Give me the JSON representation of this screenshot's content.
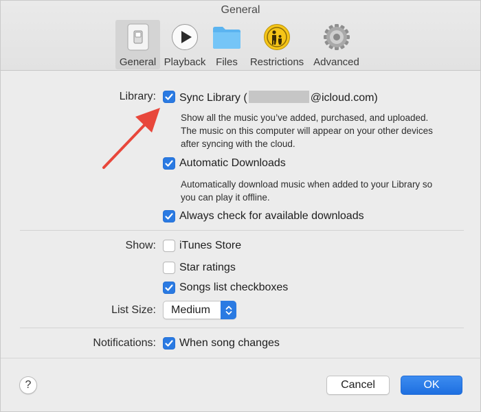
{
  "window": {
    "title": "General"
  },
  "toolbar": {
    "items": [
      {
        "label": "General",
        "icon": "general-switch-icon",
        "selected": true
      },
      {
        "label": "Playback",
        "icon": "play-icon",
        "selected": false
      },
      {
        "label": "Files",
        "icon": "folder-icon",
        "selected": false
      },
      {
        "label": "Restrictions",
        "icon": "parental-controls-icon",
        "selected": false
      },
      {
        "label": "Advanced",
        "icon": "gear-icon",
        "selected": false
      }
    ]
  },
  "library": {
    "label": "Library:",
    "sync": {
      "label_prefix": "Sync Library (",
      "label_suffix": "@icloud.com)",
      "checked": true
    },
    "sync_description": "Show all the music you’ve added, purchased, and uploaded. The music on this computer will appear on your other devices after syncing with the cloud.",
    "auto_downloads": {
      "label": "Automatic Downloads",
      "checked": true
    },
    "auto_downloads_description": "Automatically download music when added to your Library so you can play it offline.",
    "always_check": {
      "label": "Always check for available downloads",
      "checked": true
    }
  },
  "show": {
    "label": "Show:",
    "itunes_store": {
      "label": "iTunes Store",
      "checked": false
    },
    "star_ratings": {
      "label": "Star ratings",
      "checked": false
    },
    "songs_checkboxes": {
      "label": "Songs list checkboxes",
      "checked": true
    }
  },
  "list_size": {
    "label": "List Size:",
    "value": "Medium"
  },
  "notifications": {
    "label": "Notifications:",
    "song_changes": {
      "label": "When song changes",
      "checked": true
    }
  },
  "footer": {
    "help_label": "?",
    "cancel_label": "Cancel",
    "ok_label": "OK"
  },
  "colors": {
    "accent": "#2a7ae2",
    "annotation_arrow": "#e8473b"
  }
}
